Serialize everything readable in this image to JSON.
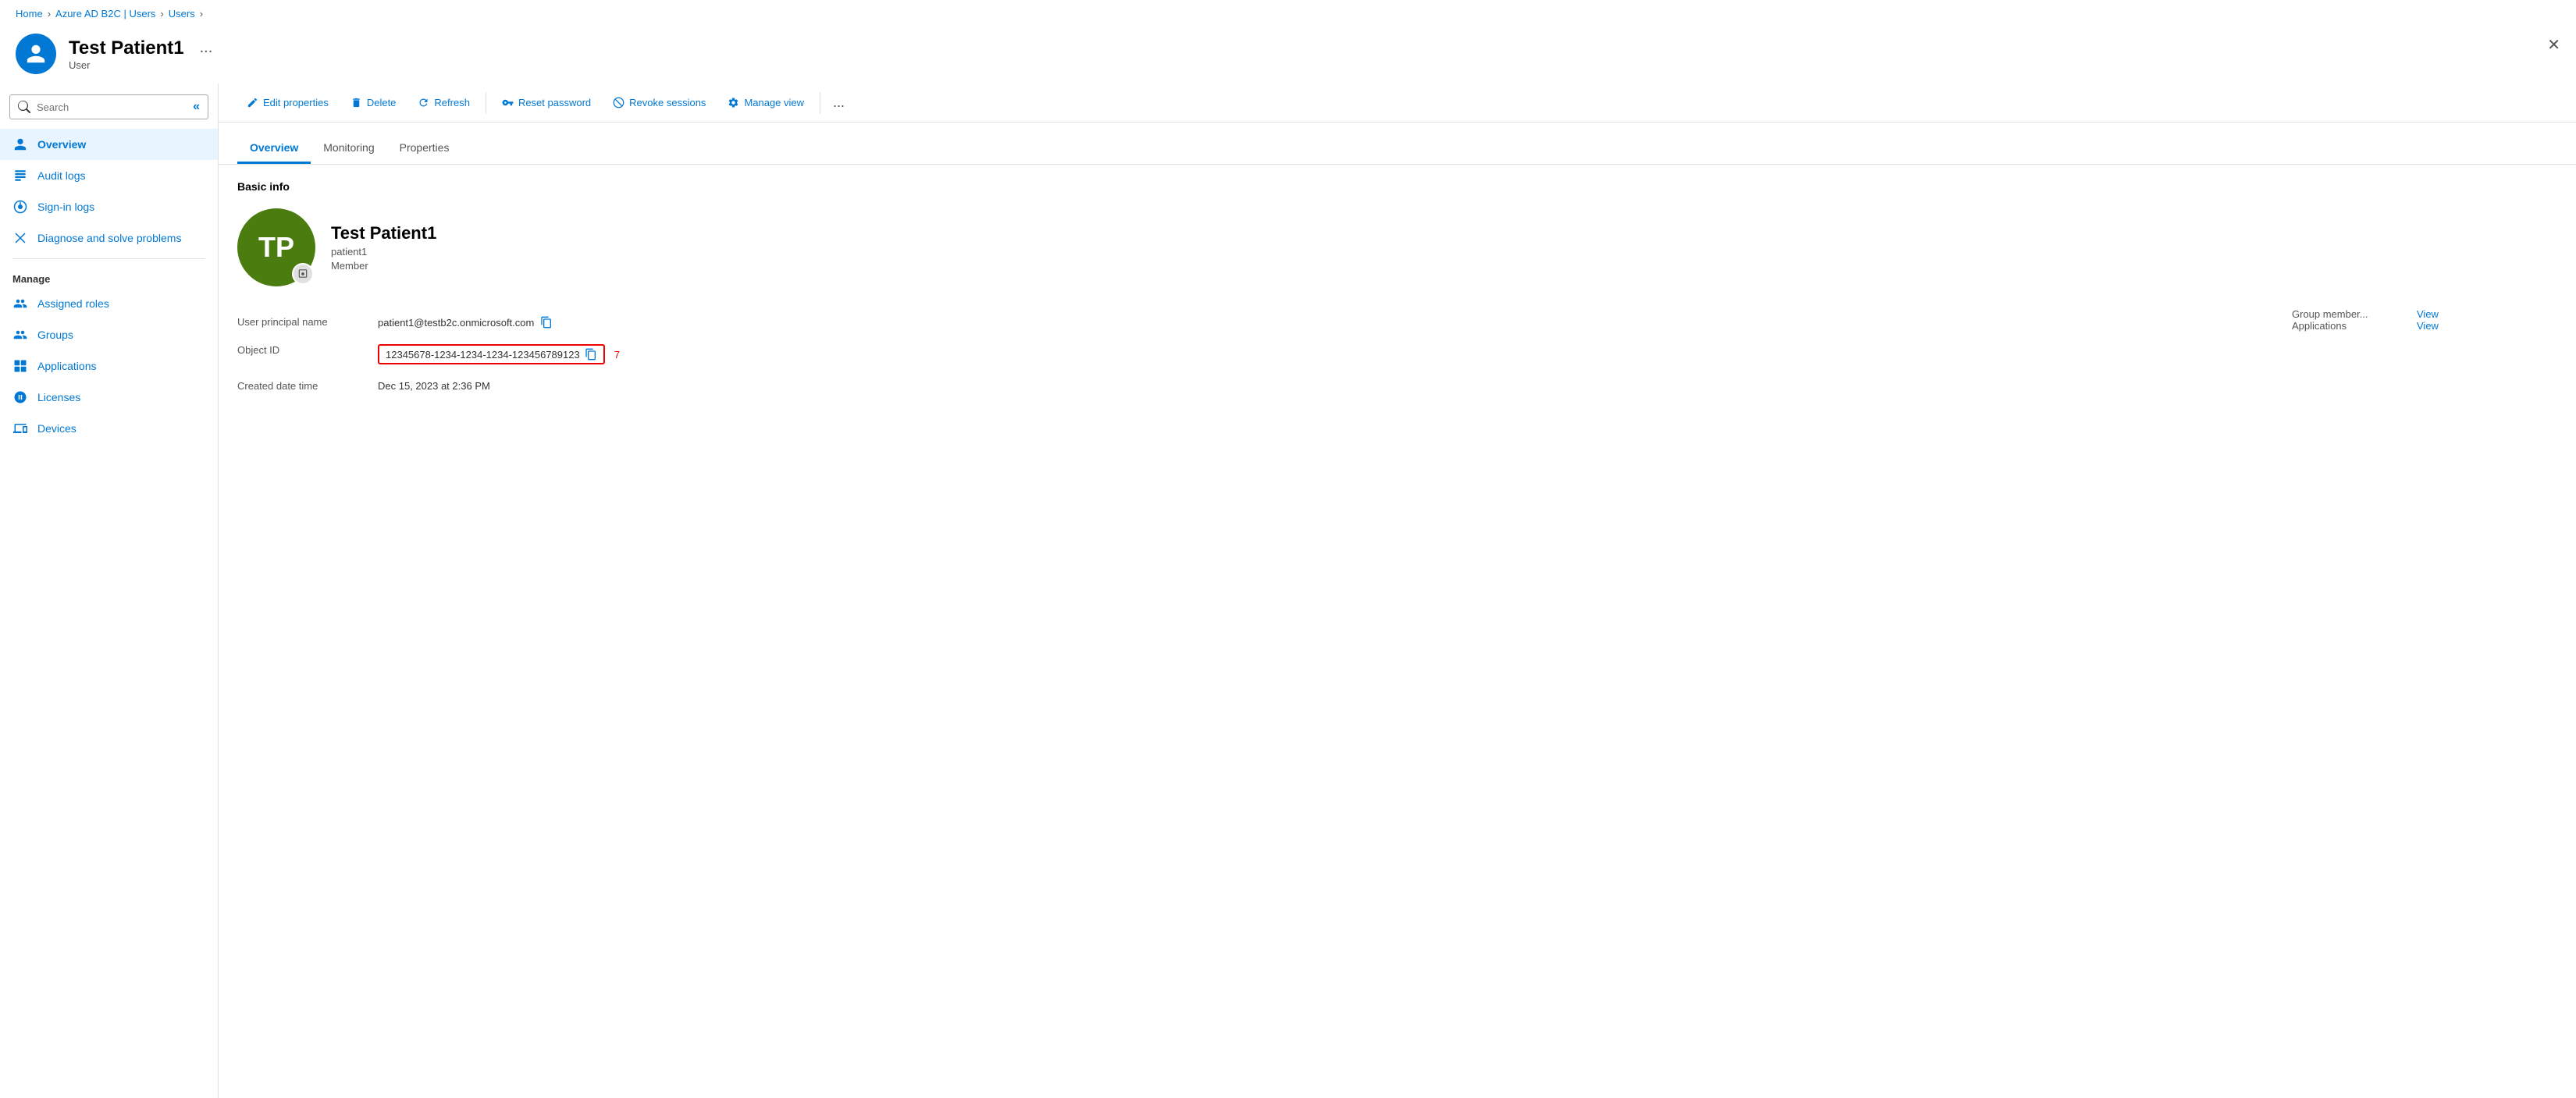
{
  "breadcrumb": {
    "items": [
      "Home",
      "Azure AD B2C | Users",
      "Users"
    ]
  },
  "header": {
    "title": "Test Patient1",
    "subtitle": "User",
    "ellipsis": "...",
    "avatar_initials": "👤"
  },
  "sidebar": {
    "search_placeholder": "Search",
    "collapse_label": "«",
    "items": [
      {
        "id": "overview",
        "label": "Overview",
        "icon": "user-icon",
        "active": true
      },
      {
        "id": "audit-logs",
        "label": "Audit logs",
        "icon": "audit-icon",
        "active": false
      },
      {
        "id": "sign-in-logs",
        "label": "Sign-in logs",
        "icon": "signin-icon",
        "active": false
      },
      {
        "id": "diagnose",
        "label": "Diagnose and solve problems",
        "icon": "diagnose-icon",
        "active": false
      }
    ],
    "section_manage": "Manage",
    "manage_items": [
      {
        "id": "assigned-roles",
        "label": "Assigned roles",
        "icon": "roles-icon"
      },
      {
        "id": "groups",
        "label": "Groups",
        "icon": "groups-icon"
      },
      {
        "id": "applications",
        "label": "Applications",
        "icon": "applications-icon"
      },
      {
        "id": "licenses",
        "label": "Licenses",
        "icon": "licenses-icon"
      },
      {
        "id": "devices",
        "label": "Devices",
        "icon": "devices-icon"
      }
    ]
  },
  "toolbar": {
    "buttons": [
      {
        "id": "edit-properties",
        "label": "Edit properties",
        "icon": "pencil-icon"
      },
      {
        "id": "delete",
        "label": "Delete",
        "icon": "trash-icon"
      },
      {
        "id": "refresh",
        "label": "Refresh",
        "icon": "refresh-icon"
      },
      {
        "id": "reset-password",
        "label": "Reset password",
        "icon": "key-icon"
      },
      {
        "id": "revoke-sessions",
        "label": "Revoke sessions",
        "icon": "sessions-icon"
      },
      {
        "id": "manage-view",
        "label": "Manage view",
        "icon": "gear-icon"
      }
    ],
    "ellipsis": "..."
  },
  "tabs": {
    "items": [
      {
        "id": "overview",
        "label": "Overview",
        "active": true
      },
      {
        "id": "monitoring",
        "label": "Monitoring",
        "active": false
      },
      {
        "id": "properties",
        "label": "Properties",
        "active": false
      }
    ]
  },
  "overview": {
    "section_title": "Basic info",
    "avatar_initials": "TP",
    "user_display_name": "Test Patient1",
    "user_id": "patient1",
    "user_role": "Member",
    "fields": {
      "user_principal_name_label": "User principal name",
      "user_principal_name_value": "patient1@testb2c.onmicrosoft.com",
      "object_id_label": "Object ID",
      "object_id_value": "12345678-1234-1234-1234-123456789123",
      "object_id_number": "7",
      "created_date_label": "Created date time",
      "created_date_value": "Dec 15, 2023 at 2:36 PM"
    },
    "right_fields": {
      "group_member_label": "Group member...",
      "group_member_value": "View",
      "applications_label": "Applications",
      "applications_value": "View"
    }
  },
  "close_button": "✕"
}
